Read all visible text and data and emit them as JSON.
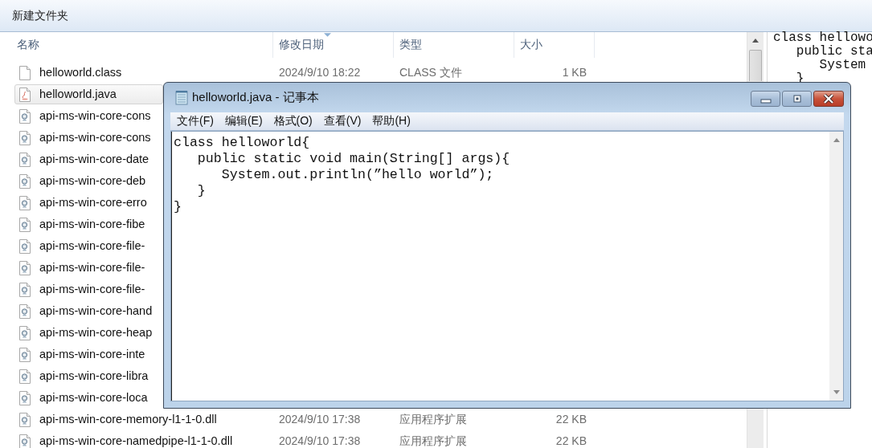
{
  "explorer": {
    "title": "新建文件夹",
    "columns": [
      {
        "label": "名称",
        "sorted": false
      },
      {
        "label": "修改日期",
        "sorted": true
      },
      {
        "label": "类型",
        "sorted": false
      },
      {
        "label": "大小",
        "sorted": false
      }
    ],
    "files": [
      {
        "name": "helloworld.class",
        "kind": "blank",
        "modified": "2024/9/10 18:22",
        "type": "CLASS 文件",
        "size": "1 KB",
        "selected": false
      },
      {
        "name": "helloworld.java",
        "kind": "java",
        "selected": true
      },
      {
        "name": "api-ms-win-core-cons",
        "kind": "dll",
        "selected": false
      },
      {
        "name": "api-ms-win-core-cons",
        "kind": "dll",
        "selected": false
      },
      {
        "name": "api-ms-win-core-date",
        "kind": "dll",
        "selected": false
      },
      {
        "name": "api-ms-win-core-deb",
        "kind": "dll",
        "selected": false
      },
      {
        "name": "api-ms-win-core-erro",
        "kind": "dll",
        "selected": false
      },
      {
        "name": "api-ms-win-core-fibe",
        "kind": "dll",
        "selected": false
      },
      {
        "name": "api-ms-win-core-file-",
        "kind": "dll",
        "selected": false
      },
      {
        "name": "api-ms-win-core-file-",
        "kind": "dll",
        "selected": false
      },
      {
        "name": "api-ms-win-core-file-",
        "kind": "dll",
        "selected": false
      },
      {
        "name": "api-ms-win-core-hand",
        "kind": "dll",
        "selected": false
      },
      {
        "name": "api-ms-win-core-heap",
        "kind": "dll",
        "selected": false
      },
      {
        "name": "api-ms-win-core-inte",
        "kind": "dll",
        "selected": false
      },
      {
        "name": "api-ms-win-core-libra",
        "kind": "dll",
        "selected": false
      },
      {
        "name": "api-ms-win-core-loca",
        "kind": "dll",
        "selected": false
      },
      {
        "name": "api-ms-win-core-memory-l1-1-0.dll",
        "kind": "dll",
        "modified": "2024/9/10 17:38",
        "type": "应用程序扩展",
        "size": "22 KB",
        "selected": false
      },
      {
        "name": "api-ms-win-core-namedpipe-l1-1-0.dll",
        "kind": "dll",
        "modified": "2024/9/10 17:38",
        "type": "应用程序扩展",
        "size": "22 KB",
        "selected": false
      }
    ],
    "preview_lines": [
      "class hellowo",
      "   public sta",
      "      System",
      "   }"
    ]
  },
  "notepad": {
    "title": "helloworld.java - 记事本",
    "menu": [
      "文件(F)",
      "编辑(E)",
      "格式(O)",
      "查看(V)",
      "帮助(H)"
    ],
    "lines": [
      "class helloworld{",
      "   public static void main(String[] args){",
      "      System.out.println(”hello world”);",
      "   }",
      "}"
    ]
  }
}
